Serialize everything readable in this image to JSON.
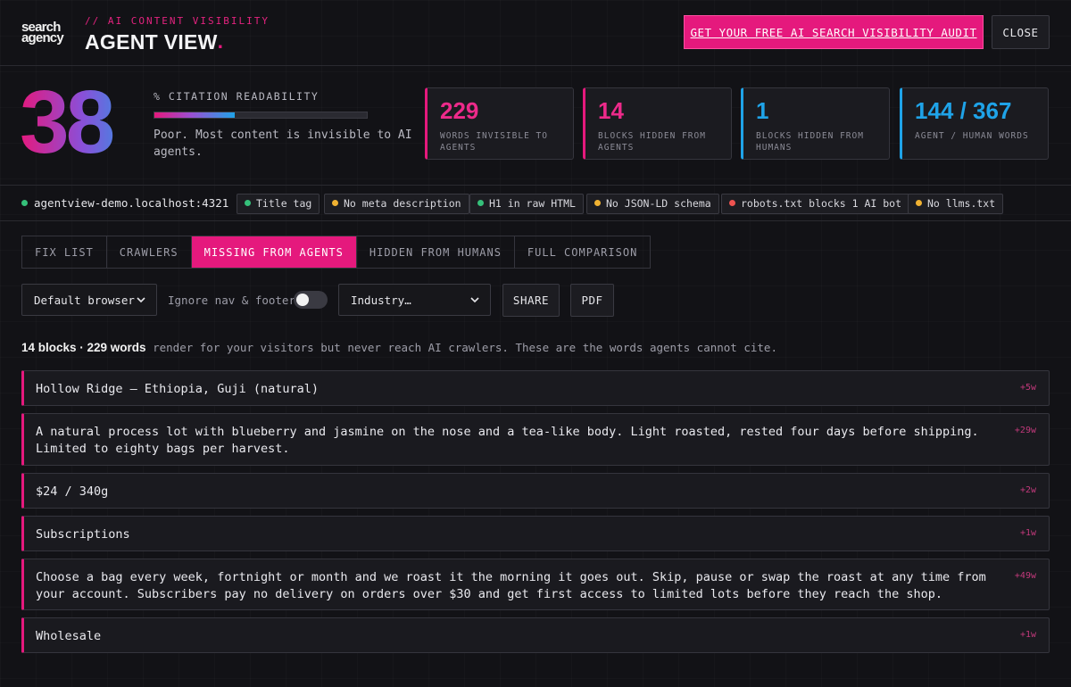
{
  "header": {
    "logo_line1": "search",
    "logo_line2": "agency",
    "kicker": "// AI CONTENT VISIBILITY",
    "title": "AGENT VIEW",
    "title_dot": ".",
    "cta_label": "GET YOUR FREE AI SEARCH VISIBILITY AUDIT",
    "close_label": "CLOSE"
  },
  "score": {
    "value": "38",
    "label": "% CITATION READABILITY",
    "progress_percent": 38,
    "description": "Poor. Most content is invisible to AI agents."
  },
  "stats": [
    {
      "value": "229",
      "label": "WORDS INVISIBLE TO AGENTS",
      "color": "#ed2a8a"
    },
    {
      "value": "14",
      "label": "BLOCKS HIDDEN FROM AGENTS",
      "color": "#ed2a8a"
    },
    {
      "value": "1",
      "label": "BLOCKS HIDDEN FROM HUMANS",
      "color": "#1fa3e8"
    },
    {
      "value": "144 / 367",
      "label": "AGENT / HUMAN WORDS",
      "color": "#1fa3e8"
    }
  ],
  "status": {
    "host": "agentview-demo.localhost:4321",
    "host_status_color": "#35c07a",
    "chips": [
      {
        "label": "Title tag",
        "status": "ok",
        "color": "#35c07a"
      },
      {
        "label": "No meta description",
        "status": "warn",
        "color": "#f0b232"
      },
      {
        "label": "H1 in raw HTML",
        "status": "ok",
        "color": "#35c07a"
      },
      {
        "label": "No JSON-LD schema",
        "status": "warn",
        "color": "#f0b232"
      },
      {
        "label": "robots.txt blocks 1 AI bot",
        "status": "error",
        "color": "#ef5350"
      },
      {
        "label": "No llms.txt",
        "status": "warn",
        "color": "#f0b232"
      }
    ]
  },
  "tabs": [
    {
      "label": "FIX LIST",
      "active": false
    },
    {
      "label": "CRAWLERS",
      "active": false
    },
    {
      "label": "MISSING FROM AGENTS",
      "active": true
    },
    {
      "label": "HIDDEN FROM HUMANS",
      "active": false
    },
    {
      "label": "FULL COMPARISON",
      "active": false
    }
  ],
  "controls": {
    "browser_select": "Default browser",
    "ignore_label": "Ignore nav & footer",
    "ignore_on": false,
    "industry_select": "Industry…",
    "share_label": "SHARE",
    "pdf_label": "PDF"
  },
  "summary": {
    "bold": "14 blocks · 229 words",
    "rest": " render for your visitors but never reach AI crawlers. These are the words agents cannot cite."
  },
  "blocks": [
    {
      "text": "Hollow Ridge — Ethiopia, Guji (natural)",
      "count": "+5w"
    },
    {
      "text": "A natural process lot with blueberry and jasmine on the nose and a tea-like body. Light roasted, rested four days before shipping. Limited to eighty bags per harvest.",
      "count": "+29w"
    },
    {
      "text": "$24 / 340g",
      "count": "+2w"
    },
    {
      "text": "Subscriptions",
      "count": "+1w"
    },
    {
      "text": "Choose a bag every week, fortnight or month and we roast it the morning it goes out. Skip, pause or swap the roast at any time from your account. Subscribers pay no delivery on orders over $30 and get first access to limited lots before they reach the shop.",
      "count": "+49w"
    },
    {
      "text": "Wholesale",
      "count": "+1w"
    }
  ]
}
